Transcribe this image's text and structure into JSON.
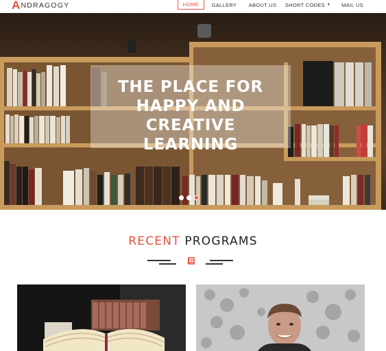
{
  "brand": {
    "first_letter": "A",
    "rest": "NDRAGOGY"
  },
  "nav": {
    "items": [
      {
        "label": "HOME",
        "active": true
      },
      {
        "label": "GALLERY",
        "active": false
      },
      {
        "label": "ABOUT US",
        "active": false
      },
      {
        "label": "SHORT CODES",
        "active": false,
        "dropdown": true
      },
      {
        "label": "MAIL US",
        "active": false
      }
    ]
  },
  "hero": {
    "title_line1": "THE PLACE FOR",
    "title_line2": "HAPPY AND CREATIVE",
    "title_line3": "LEARNING",
    "slides": 3,
    "active_slide": 3
  },
  "section": {
    "title_accent": "RECENT",
    "title_rest": "PROGRAMS",
    "icon": "book-icon"
  },
  "cards": [
    {
      "image": "open-books-photo"
    },
    {
      "image": "student-portrait-photo"
    }
  ],
  "colors": {
    "accent": "#e8533b",
    "text": "#222222"
  }
}
